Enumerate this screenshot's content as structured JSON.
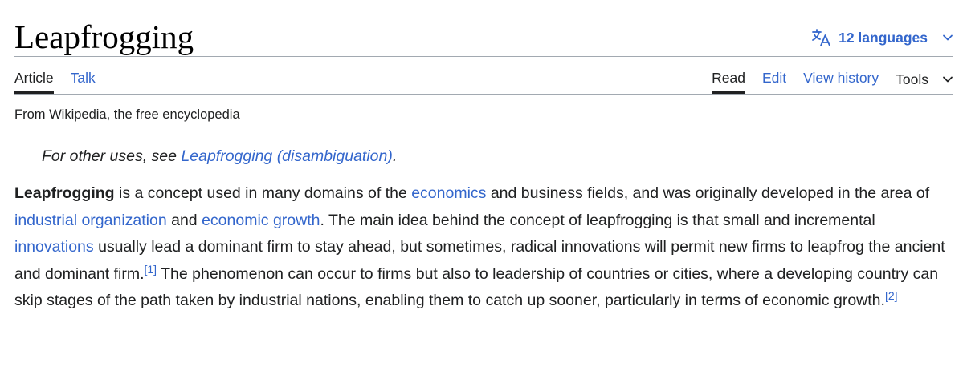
{
  "page": {
    "title": "Leapfrogging",
    "languages_label": "12 languages",
    "tagline": "From Wikipedia, the free encyclopedia"
  },
  "icons": {
    "language": "translate-icon",
    "dropdown": "chevron-down-icon"
  },
  "tabs": {
    "namespaces": [
      {
        "label": "Article",
        "selected": true
      },
      {
        "label": "Talk",
        "selected": false
      }
    ],
    "views": [
      {
        "label": "Read",
        "selected": true
      },
      {
        "label": "Edit",
        "selected": false
      },
      {
        "label": "View history",
        "selected": false
      },
      {
        "label": "Tools",
        "selected": false
      }
    ]
  },
  "hatnote": {
    "prefix": "For other uses, see ",
    "link": "Leapfrogging (disambiguation)",
    "suffix": "."
  },
  "paragraph": {
    "bold_term": "Leapfrogging",
    "t1": " is a concept used in many domains of the ",
    "l1": "economics",
    "t2": " and business fields, and was originally developed in the area of ",
    "l2": "industrial organization",
    "t3": " and ",
    "l3": "economic growth",
    "t4": ". The main idea behind the concept of leapfrogging is that small and incremental ",
    "l4": "innovations",
    "t5": " usually lead a dominant firm to stay ahead, but sometimes, radical innovations will permit new firms to leapfrog the ancient and dominant firm.",
    "ref1": "[1]",
    "t6": " The phenomenon can occur to firms but also to leadership of countries or cities, where a developing country can skip stages of the path taken by industrial nations, enabling them to catch up sooner, particularly in terms of economic growth.",
    "ref2": "[2]"
  },
  "colors": {
    "link": "#3366cc",
    "text": "#202122",
    "rule": "#a2a9b1"
  }
}
